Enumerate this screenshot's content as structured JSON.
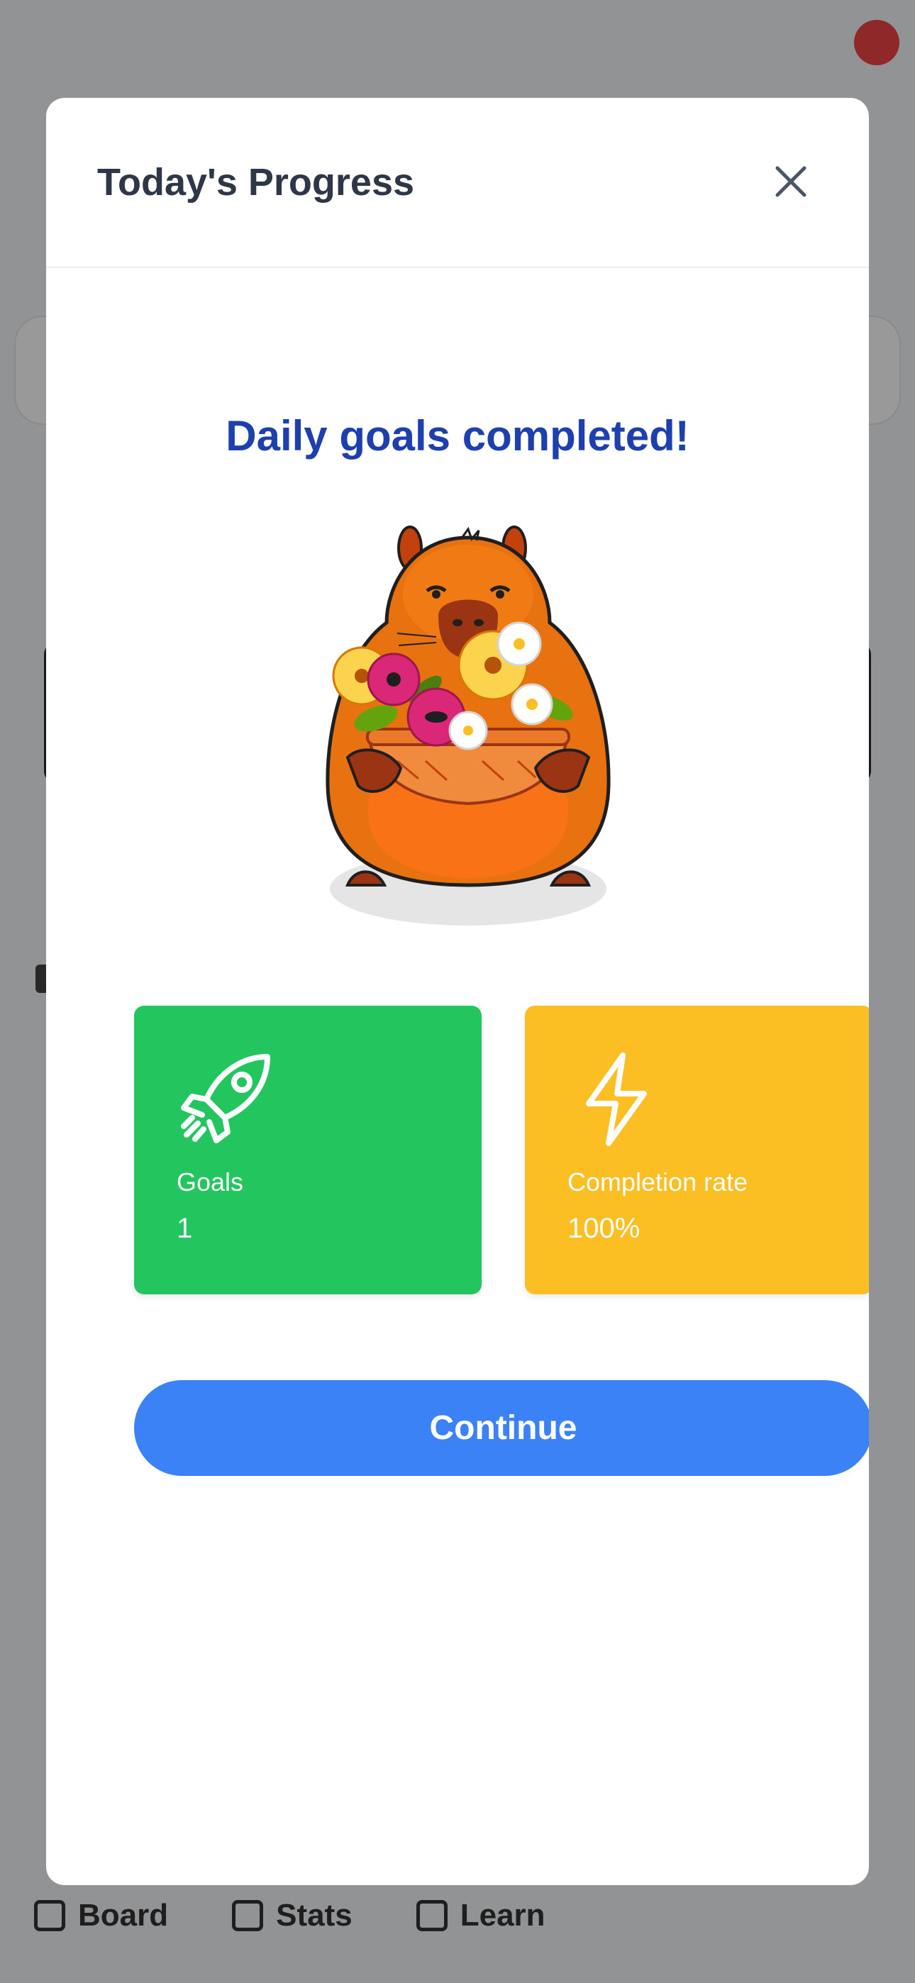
{
  "background": {
    "nav": [
      {
        "label": "Board",
        "icon": "board-icon"
      },
      {
        "label": "Stats",
        "icon": "stats-icon"
      },
      {
        "label": "Learn",
        "icon": "learn-icon"
      }
    ]
  },
  "modal": {
    "title": "Today's Progress",
    "close_icon": "close-icon",
    "headline": "Daily goals completed!",
    "illustration": "capybara-with-flower-basket",
    "stats": [
      {
        "icon": "rocket-icon",
        "label": "Goals",
        "value": "1",
        "color": "#22c55e"
      },
      {
        "icon": "lightning-icon",
        "label": "Completion rate",
        "value": "100%",
        "color": "#fbbf24"
      }
    ],
    "continue_label": "Continue"
  },
  "colors": {
    "title": "#2d3748",
    "headline": "#1e40af",
    "primary_button": "#3b82f6"
  }
}
